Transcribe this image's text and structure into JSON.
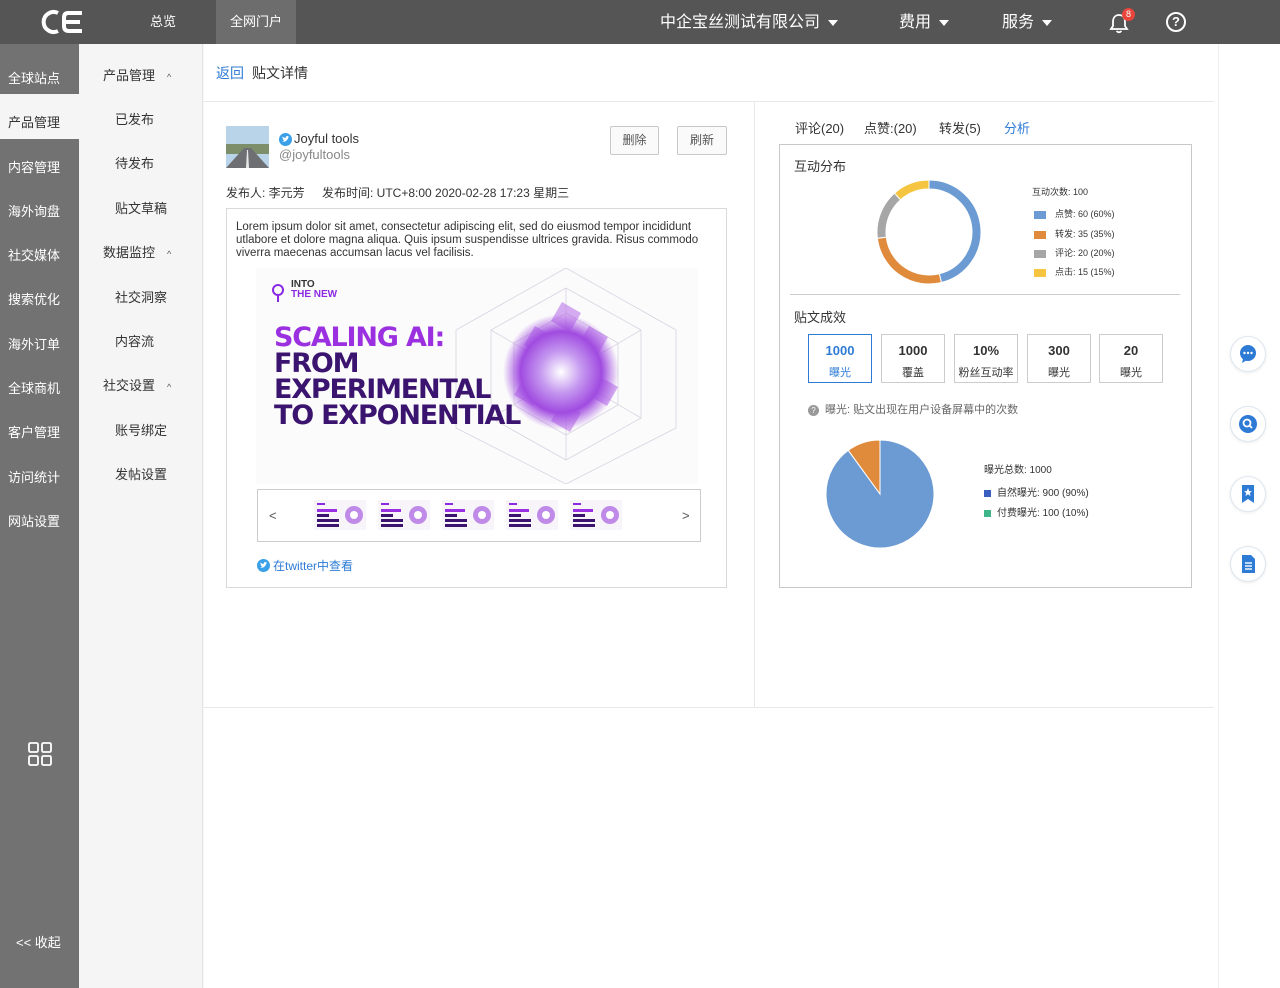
{
  "topbar": {
    "tabs": [
      "总览",
      "全网门户"
    ],
    "company": "中企宝丝测试有限公司",
    "fees": "费用",
    "services": "服务",
    "notification_count": "8",
    "help": "?"
  },
  "sidebar_main": {
    "items": [
      "全球站点",
      "产品管理",
      "内容管理",
      "海外询盘",
      "社交媒体",
      "搜索优化",
      "海外订单",
      "全球商机",
      "客户管理",
      "访问统计",
      "网站设置"
    ],
    "active": "产品管理",
    "collapse": "<< 收起"
  },
  "sidebar_sub": {
    "groups": [
      {
        "label": "产品管理",
        "items": [
          "已发布",
          "待发布",
          "贴文草稿"
        ]
      },
      {
        "label": "数据监控",
        "items": [
          "社交洞察",
          "内容流"
        ]
      },
      {
        "label": "社交设置",
        "items": [
          "账号绑定",
          "发帖设置"
        ]
      }
    ]
  },
  "breadcrumb": {
    "back": "返回",
    "title": "贴文详情"
  },
  "post": {
    "account_name": "Joyful tools",
    "account_handle": "@joyfultools",
    "delete_label": "删除",
    "refresh_label": "刷新",
    "publisher": "发布人: 李元芳",
    "publish_time": "发布时间: UTC+8:00 2020-02-28 17:23 星期三",
    "text": "Lorem ipsum dolor sit amet, consectetur adipiscing elit, sed do eiusmod tempor incididunt utlabore et dolore magna aliqua. Quis ipsum suspendisse ultrices gravida. Risus commodo viverra maecenas accumsan lacus vel facilisis.",
    "banner_tag_line1": "INTO",
    "banner_tag_line2": "THE NEW",
    "banner_headline": [
      "SCALING AI:",
      "FROM",
      "EXPERIMENTAL",
      "TO EXPONENTIAL"
    ],
    "thumb_prev": "<",
    "thumb_next": ">",
    "twitter_link": "在twitter中查看"
  },
  "analysis": {
    "tabs": [
      "评论(20)",
      "点赞:(20)",
      "转发(5)",
      "分析"
    ],
    "active_tab": "分析",
    "interaction_title": "互动分布",
    "interaction_total": "互动次数:  100",
    "interaction_legend": [
      {
        "label": "点赞: 60  (60%)",
        "value": 60,
        "color": "#6b9bd2"
      },
      {
        "label": "转发: 35  (35%)",
        "value": 35,
        "color": "#e08a3c"
      },
      {
        "label": "评论: 20  (20%)",
        "value": 20,
        "color": "#a6a6a6"
      },
      {
        "label": "点击: 15  (15%)",
        "value": 15,
        "color": "#f5c542"
      }
    ],
    "effect_title": "贴文成效",
    "stats": [
      {
        "value": "1000",
        "label": "曝光"
      },
      {
        "value": "1000",
        "label": "覆盖"
      },
      {
        "value": "10%",
        "label": "粉丝互动率"
      },
      {
        "value": "300",
        "label": "曝光"
      },
      {
        "value": "20",
        "label": "曝光"
      }
    ],
    "note": "曝光: 贴文出现在用户设备屏幕中的次数",
    "exposure_total": "曝光总数: 1000",
    "exposure_legend": [
      {
        "label": "自然曝光: 900  (90%)",
        "value": 90,
        "color": "#3b5fc0"
      },
      {
        "label": "付费曝光: 100  (10%)",
        "value": 10,
        "color": "#3fb58a"
      }
    ],
    "exposure_pie_colors": [
      "#6b9bd2",
      "#e08a3c"
    ]
  }
}
